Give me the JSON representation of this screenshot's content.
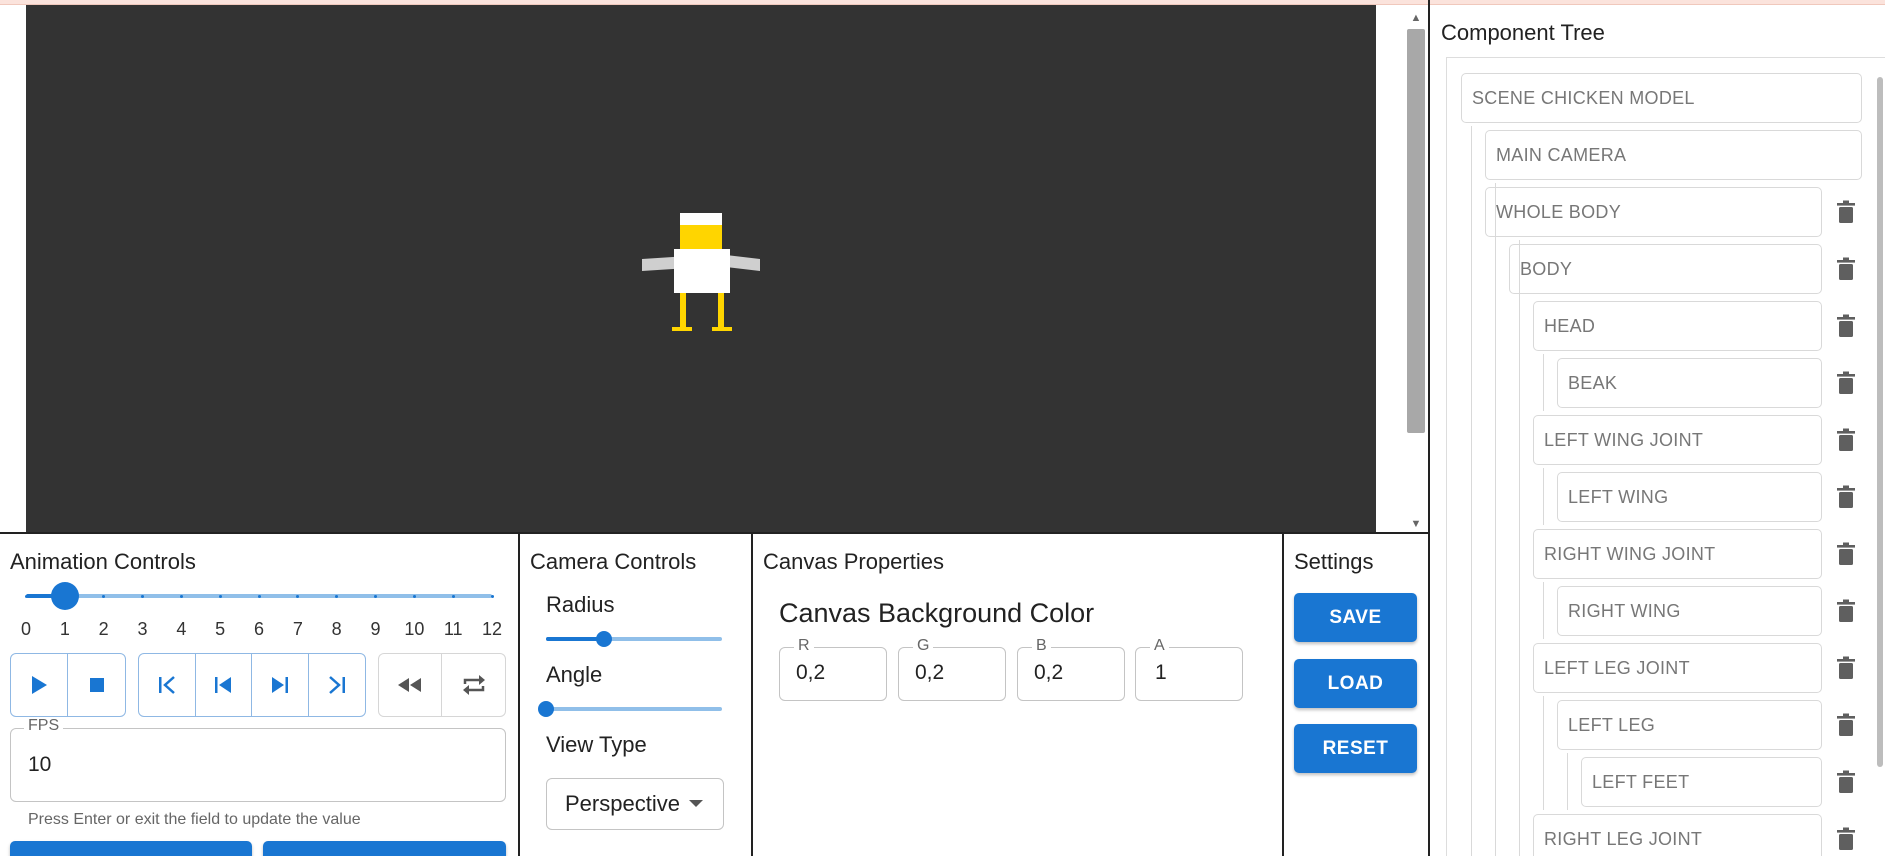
{
  "tree_panel": {
    "title": "Component Tree",
    "nodes": [
      {
        "label": "SCENE CHICKEN MODEL",
        "deletable": false
      },
      {
        "label": "MAIN CAMERA",
        "deletable": false
      },
      {
        "label": "WHOLE BODY",
        "deletable": true
      },
      {
        "label": "BODY",
        "deletable": true
      },
      {
        "label": "HEAD",
        "deletable": true
      },
      {
        "label": "BEAK",
        "deletable": true
      },
      {
        "label": "LEFT WING JOINT",
        "deletable": true
      },
      {
        "label": "LEFT WING",
        "deletable": true
      },
      {
        "label": "RIGHT WING JOINT",
        "deletable": true
      },
      {
        "label": "RIGHT WING",
        "deletable": true
      },
      {
        "label": "LEFT LEG JOINT",
        "deletable": true
      },
      {
        "label": "LEFT LEG",
        "deletable": true
      },
      {
        "label": "LEFT FEET",
        "deletable": true
      },
      {
        "label": "RIGHT LEG JOINT",
        "deletable": true
      }
    ]
  },
  "animation": {
    "title": "Animation Controls",
    "frame_value": 1,
    "frame_min": 0,
    "frame_max": 12,
    "tick_labels": [
      "0",
      "1",
      "2",
      "3",
      "4",
      "5",
      "6",
      "7",
      "8",
      "9",
      "10",
      "11",
      "12"
    ],
    "fps_label": "FPS",
    "fps_value": "10",
    "fps_helper": "Press Enter or exit the field to update the value"
  },
  "camera": {
    "title": "Camera Controls",
    "radius_label": "Radius",
    "radius_value": 0.33,
    "angle_label": "Angle",
    "angle_value": 0.0,
    "view_type_label": "View Type",
    "view_type_value": "Perspective"
  },
  "canvas": {
    "title": "Canvas Properties",
    "bg_heading": "Canvas Background Color",
    "channels": [
      {
        "label": "R",
        "value": "0,2"
      },
      {
        "label": "G",
        "value": "0,2"
      },
      {
        "label": "B",
        "value": "0,2"
      },
      {
        "label": "A",
        "value": "1"
      }
    ]
  },
  "settings": {
    "title": "Settings",
    "save_label": "SAVE",
    "load_label": "LOAD",
    "reset_label": "RESET"
  },
  "colors": {
    "accent": "#1976d2",
    "viewport_bg": "#333333",
    "chicken_body": "#ffffff",
    "chicken_head_band": "#ffd500",
    "chicken_wing": "#cccccc",
    "chicken_leg": "#ffd500"
  }
}
